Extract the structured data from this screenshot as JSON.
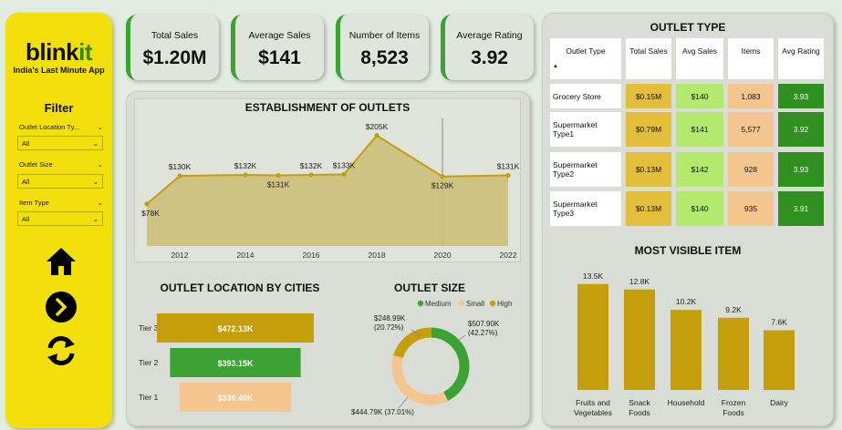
{
  "brand": {
    "name_main": "blink",
    "name_accent": "it",
    "tagline": "India's Last Minute App"
  },
  "filter": {
    "title": "Filter",
    "fields": [
      {
        "label": "Outlet Location Ty...",
        "value": "All"
      },
      {
        "label": "Outlet Size",
        "value": "All"
      },
      {
        "label": "Item Type",
        "value": "All"
      }
    ]
  },
  "nav": {
    "home": "home-icon",
    "next": "chevron-right-icon",
    "refresh": "refresh-icon"
  },
  "kpis": [
    {
      "title": "Total Sales",
      "value": "$1.20M"
    },
    {
      "title": "Average Sales",
      "value": "$141"
    },
    {
      "title": "Number of Items",
      "value": "8,523"
    },
    {
      "title": "Average Rating",
      "value": "3.92"
    }
  ],
  "colors": {
    "accent_green": "#3aa334",
    "brand_yellow": "#f2df0c",
    "gold": "#c49f0b",
    "peach": "#f4c58f",
    "light_green": "#b3ea6d",
    "dark_green": "#2f8f1f"
  },
  "outlet_type_table": {
    "title": "OUTLET TYPE",
    "headers": [
      "Outlet Type",
      "Total Sales",
      "Avg Sales",
      "Items",
      "Avg Rating"
    ],
    "rows": [
      {
        "type": "Grocery Store",
        "total": "$0.15M",
        "avg": "$140",
        "items": "1,083",
        "rating": "3.93"
      },
      {
        "type": "Supermarket Type1",
        "total": "$0.79M",
        "avg": "$141",
        "items": "5,577",
        "rating": "3.92"
      },
      {
        "type": "Supermarket Type2",
        "total": "$0.13M",
        "avg": "$142",
        "items": "928",
        "rating": "3.93"
      },
      {
        "type": "Supermarket Type3",
        "total": "$0.13M",
        "avg": "$140",
        "items": "935",
        "rating": "3.91"
      }
    ]
  },
  "chart_data": [
    {
      "type": "area",
      "title": "ESTABLISHMENT OF OUTLETS",
      "x": [
        2011,
        2012,
        2014,
        2015,
        2016,
        2017,
        2018,
        2020,
        2022
      ],
      "values": [
        78,
        130,
        132,
        131,
        132,
        133,
        205,
        129,
        131
      ],
      "labels": [
        "$78K",
        "$130K",
        "$132K",
        "$131K",
        "$132K",
        "$133K",
        "$205K",
        "$129K",
        "$131K"
      ],
      "xticks": [
        "2012",
        "2014",
        "2016",
        "2018",
        "2020",
        "2022"
      ],
      "unit": "K"
    },
    {
      "type": "bar",
      "title": "OUTLET LOCATION BY CITIES",
      "categories": [
        "Tier 3",
        "Tier 2",
        "Tier 1"
      ],
      "values": [
        472.13,
        393.15,
        336.4
      ],
      "labels": [
        "$472.13K",
        "$393.15K",
        "$336.40K"
      ],
      "colors": [
        "#c49f0b",
        "#3aa334",
        "#f4c58f"
      ]
    },
    {
      "type": "pie",
      "title": "OUTLET SIZE",
      "legend": [
        "Medium",
        "Small",
        "High"
      ],
      "categories": [
        "Medium",
        "Small",
        "High"
      ],
      "values": [
        507.9,
        444.79,
        248.99
      ],
      "percents": [
        42.27,
        37.01,
        20.72
      ],
      "labels": [
        "$507.90K (42.27%)",
        "$444.79K (37.01%)",
        "$248.99K (20.72%)"
      ],
      "colors": [
        "#3aa334",
        "#f4c58f",
        "#c49f0b"
      ]
    },
    {
      "type": "bar",
      "title": "MOST VISIBLE ITEM",
      "categories": [
        "Fruits and Vegetables",
        "Snack Foods",
        "Household",
        "Frozen Foods",
        "Dairy"
      ],
      "values": [
        13.5,
        12.8,
        10.2,
        9.2,
        7.6
      ],
      "labels": [
        "13.5K",
        "12.8K",
        "10.2K",
        "9.2K",
        "7.6K"
      ]
    }
  ]
}
